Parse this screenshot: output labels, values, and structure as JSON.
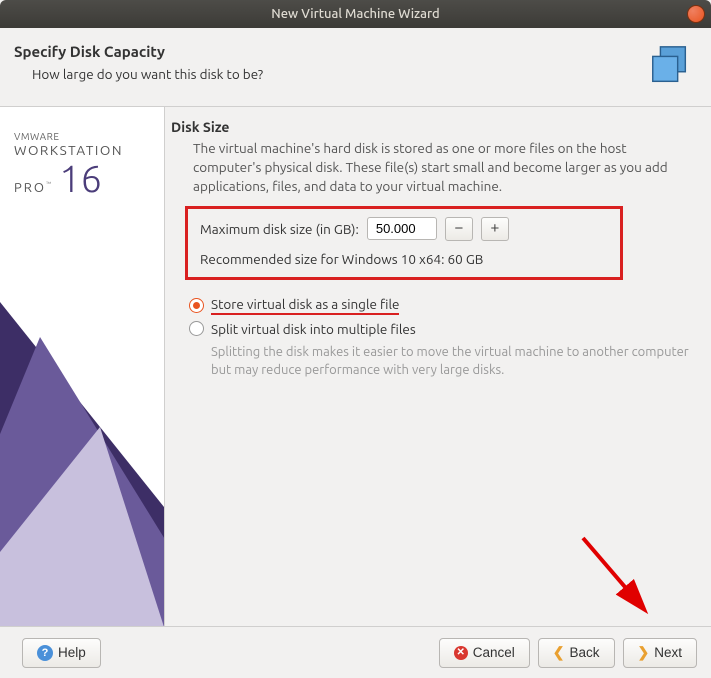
{
  "window": {
    "title": "New Virtual Machine Wizard"
  },
  "header": {
    "title": "Specify Disk Capacity",
    "subtitle": "How large do you want this disk to be?"
  },
  "brand": {
    "vmware": "VMWARE",
    "workstation": "WORKSTATION",
    "pro": "PRO",
    "version": "16"
  },
  "disk": {
    "section_title": "Disk Size",
    "description": "The virtual machine's hard disk is stored as one or more files on the host computer's physical disk. These file(s) start small and become larger as you add applications, files, and data to your virtual machine.",
    "max_label": "Maximum disk size (in GB):",
    "max_value": "50.000",
    "recommended": "Recommended size for Windows 10 x64: 60 GB",
    "options": {
      "single": "Store virtual disk as a single file",
      "split": "Split virtual disk into multiple files",
      "split_help": "Splitting the disk makes it easier to move the virtual machine to another computer but may reduce performance with very large disks."
    }
  },
  "footer": {
    "help": "Help",
    "cancel": "Cancel",
    "back": "Back",
    "next": "Next"
  }
}
